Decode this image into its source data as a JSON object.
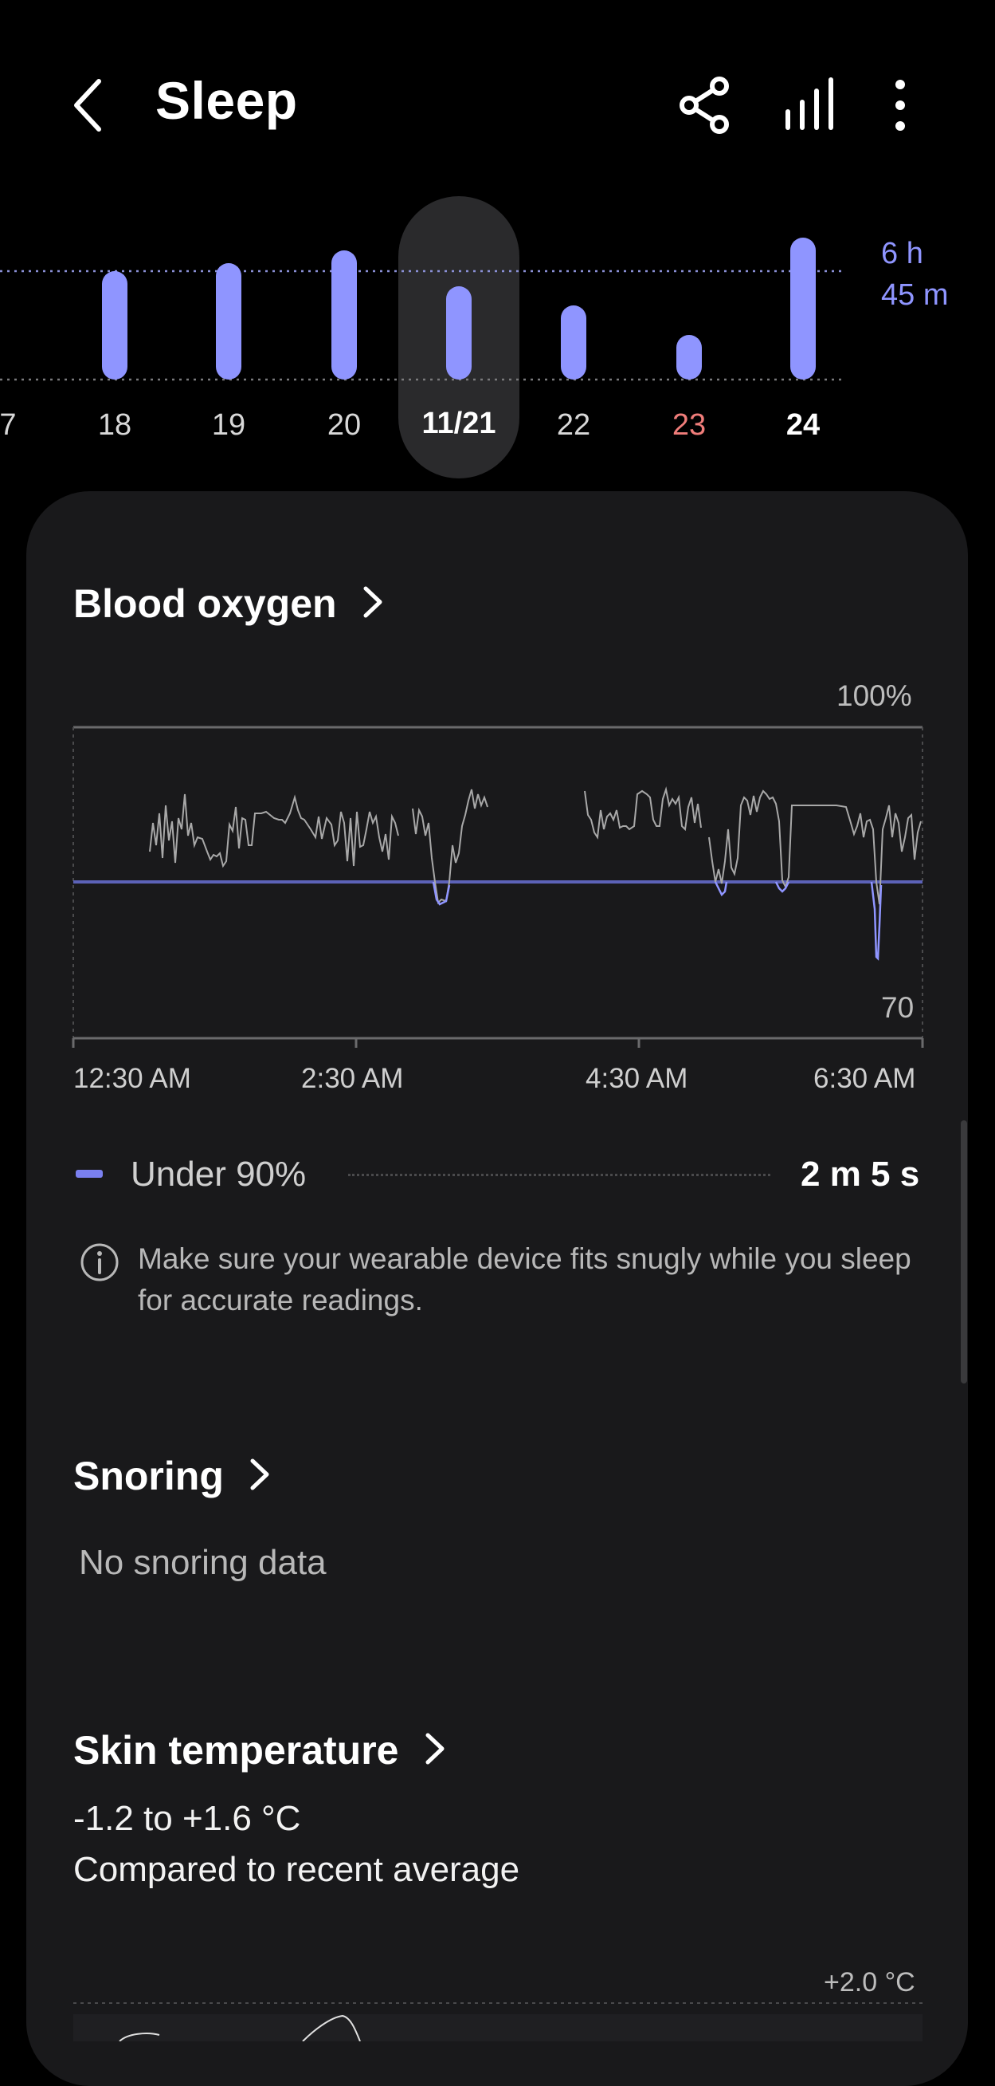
{
  "header": {
    "title": "Sleep",
    "back_icon": "chevron-left-icon",
    "share_icon": "share-icon",
    "stats_icon": "bar-chart-icon",
    "more_icon": "more-vertical-icon"
  },
  "week": {
    "days": [
      {
        "label": "7"
      },
      {
        "label": "18"
      },
      {
        "label": "19"
      },
      {
        "label": "20"
      },
      {
        "label": "11/21"
      },
      {
        "label": "22"
      },
      {
        "label": "23"
      },
      {
        "label": "24"
      }
    ],
    "duration_hours": "6 h",
    "duration_minutes": "45 m",
    "accent": "#8f95ff"
  },
  "blood_oxygen": {
    "title": "Blood oxygen",
    "y_max_label": "100%",
    "y_min_label": "70",
    "x_ticks": [
      "12:30 AM",
      "2:30 AM",
      "4:30 AM",
      "6:30 AM"
    ],
    "legend_label": "Under 90%",
    "legend_value": "2 m 5 s",
    "info_text": "Make sure your wearable device fits snugly while you sleep for accurate readings."
  },
  "snoring": {
    "title": "Snoring",
    "empty_text": "No snoring data"
  },
  "skin_temperature": {
    "title": "Skin temperature",
    "range": "-1.2 to +1.6 °C",
    "subtitle": "Compared to recent average",
    "y_max_label": "+2.0 °C"
  }
}
